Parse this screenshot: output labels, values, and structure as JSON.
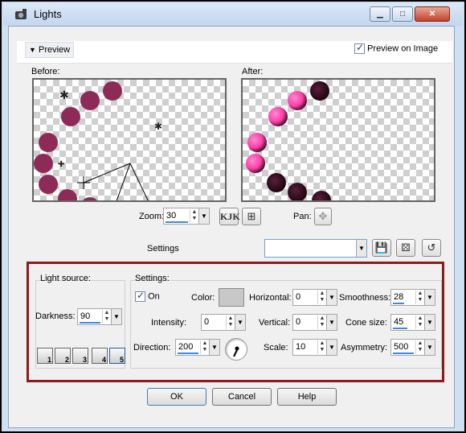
{
  "window": {
    "title": "Lights"
  },
  "preview": {
    "toggle_label": "Preview",
    "preview_on_image_label": "Preview on Image",
    "preview_on_image_checked": true
  },
  "before": {
    "label": "Before:"
  },
  "after": {
    "label": "After:"
  },
  "zoom": {
    "label": "Zoom:",
    "value": "30",
    "pan_label": "Pan:",
    "badge": "KJK"
  },
  "settings_bar": {
    "label": "Settings",
    "preset_value": ""
  },
  "light_source": {
    "title": "Light source:",
    "darkness_label": "Darkness:",
    "darkness_value": "90",
    "presets": [
      "1",
      "2",
      "3",
      "4",
      "5"
    ]
  },
  "settings": {
    "title": "Settings:",
    "on_label": "On",
    "on_checked": true,
    "color_label": "Color:",
    "intensity_label": "Intensity:",
    "intensity_value": "0",
    "direction_label": "Direction:",
    "direction_value": "200",
    "horizontal_label": "Horizontal:",
    "horizontal_value": "0",
    "vertical_label": "Vertical:",
    "vertical_value": "0",
    "scale_label": "Scale:",
    "scale_value": "10",
    "smoothness_label": "Smoothness:",
    "smoothness_value": "28",
    "cone_size_label": "Cone size:",
    "cone_size_value": "45",
    "asymmetry_label": "Asymmetry:",
    "asymmetry_value": "500"
  },
  "buttons": {
    "ok": "OK",
    "cancel": "Cancel",
    "help": "Help"
  },
  "colors": {
    "highlight_border": "#8c1c1c",
    "accent": "#3c8ae0",
    "ball_before": "#8e2a57",
    "ball_after": "#ff4fb0"
  }
}
